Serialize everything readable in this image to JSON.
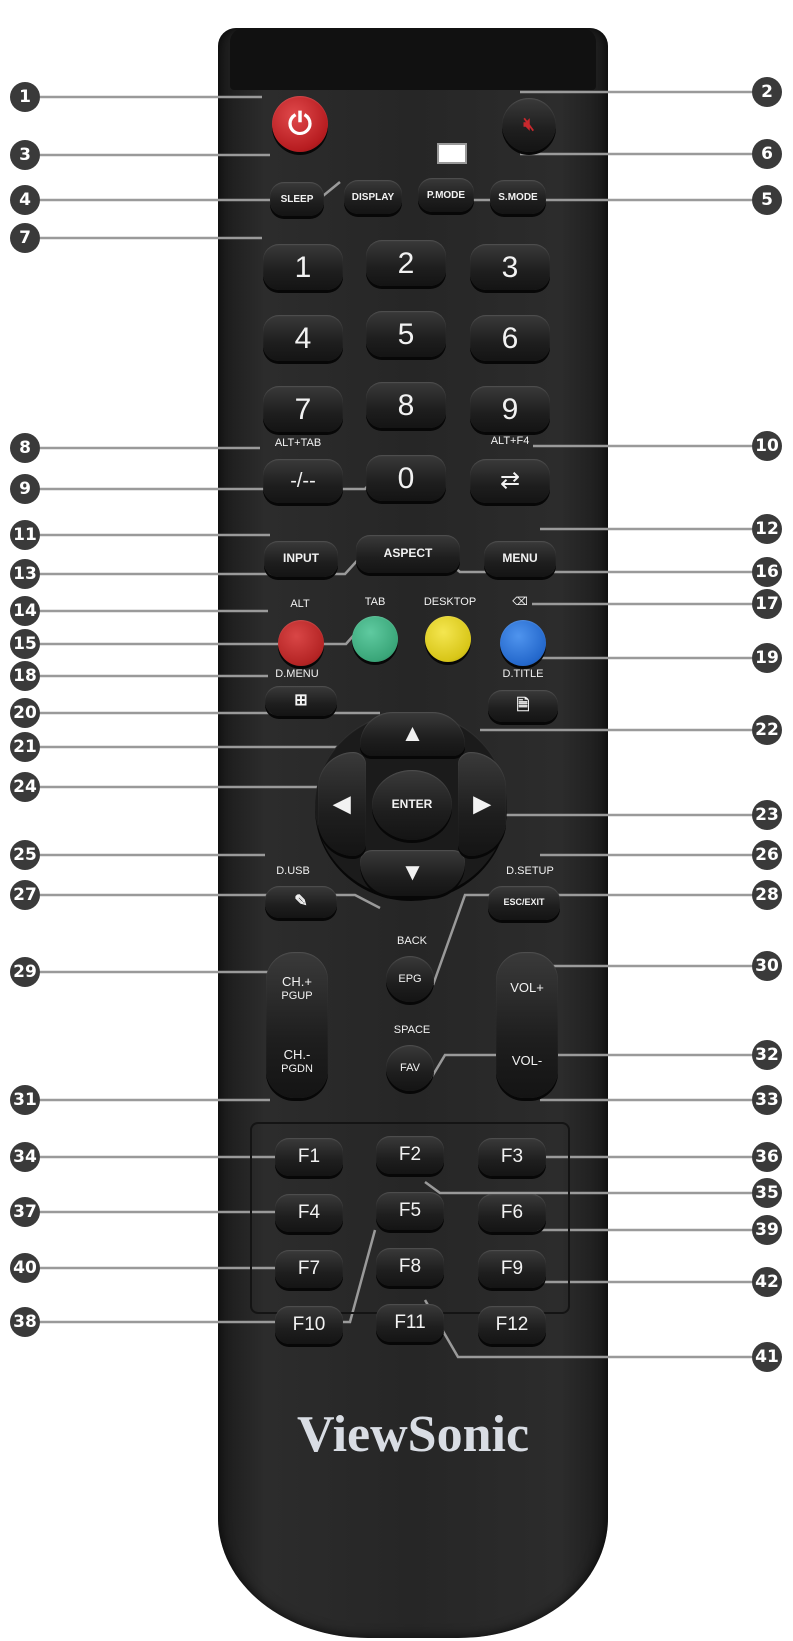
{
  "brand": "ViewSonic",
  "buttons": {
    "power": "power-symbol",
    "mute": "mute-symbol",
    "sleep": "SLEEP",
    "display": "DISPLAY",
    "pmode": "P.MODE",
    "smode": "S.MODE",
    "digits": [
      "1",
      "2",
      "3",
      "4",
      "5",
      "6",
      "7",
      "8",
      "9"
    ],
    "zero": "0",
    "dash": "-/--",
    "return_symbol": "return-arrow",
    "input": "INPUT",
    "aspect": "ASPECT",
    "menu": "MENU",
    "enter": "ENTER",
    "epg": "EPG",
    "fav": "FAV",
    "esc_exit": "ESC/EXIT",
    "ch_plus": "CH.+",
    "pgup": "PGUP",
    "ch_minus": "CH.-",
    "pgdn": "PGDN",
    "vol_plus": "VOL+",
    "vol_minus": "VOL-",
    "fkeys": [
      "F1",
      "F2",
      "F3",
      "F4",
      "F5",
      "F6",
      "F7",
      "F8",
      "F9",
      "F10",
      "F11",
      "F12"
    ]
  },
  "labels": {
    "alt_tab": "ALT+TAB",
    "alt_f4": "ALT+F4",
    "alt": "ALT",
    "tab": "TAB",
    "desktop": "DESKTOP",
    "backspace": "⌫",
    "dmenu": "D.MENU",
    "dtitle": "D.TITLE",
    "dusb": "D.USB",
    "dsetup": "D.SETUP",
    "back": "BACK",
    "space": "SPACE"
  },
  "callouts": [
    "1",
    "2",
    "3",
    "4",
    "5",
    "6",
    "7",
    "8",
    "9",
    "10",
    "11",
    "12",
    "13",
    "14",
    "15",
    "16",
    "17",
    "18",
    "19",
    "20",
    "21",
    "22",
    "23",
    "24",
    "25",
    "26",
    "27",
    "28",
    "29",
    "30",
    "31",
    "32",
    "33",
    "34",
    "35",
    "36",
    "37",
    "38",
    "39",
    "40",
    "41",
    "42"
  ],
  "colors": {
    "power": "#c8282d",
    "red": "#c22a2a",
    "green": "#3fae83",
    "yellow": "#e2d21c",
    "blue": "#2b74d6"
  }
}
